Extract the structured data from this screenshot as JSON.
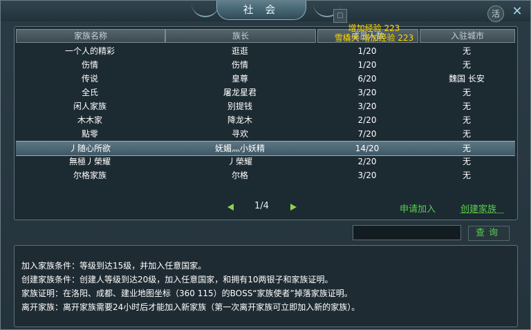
{
  "window": {
    "title": "社 会",
    "help_label": "活",
    "close_label": "✕",
    "square_btn_label": "□"
  },
  "table": {
    "columns": [
      "家族名称",
      "族长",
      "成员人数",
      "入驻城市"
    ],
    "rows": [
      [
        "一个人的精彩",
        "逛逛",
        "1/20",
        "无"
      ],
      [
        "伤情",
        "伤情",
        "1/20",
        "无"
      ],
      [
        "传说",
        "皇尊",
        "6/20",
        "魏国 长安"
      ],
      [
        "全氏",
        "屠龙星君",
        "3/20",
        "无"
      ],
      [
        "闲人家族",
        "别提钱",
        "3/20",
        "无"
      ],
      [
        "木木家",
        "降龙木",
        "2/20",
        "无"
      ],
      [
        "點零",
        "寻欢",
        "7/20",
        "无"
      ],
      [
        "丿随心所欲",
        "妩媚灬小妖精",
        "14/20",
        "无"
      ],
      [
        "無極丿榮耀",
        "丿榮耀",
        "2/20",
        "无"
      ],
      [
        "尔格家族",
        "尔格",
        "3/20",
        "无"
      ]
    ],
    "selected_index": 7
  },
  "xp_popup": {
    "line1": "增加经验 223",
    "line2": "雪橇犬 增加经验 223"
  },
  "pager": {
    "current": "1/4"
  },
  "actions": {
    "apply": "申请加入",
    "create": "创建家族",
    "search_placeholder": "",
    "query": "查询"
  },
  "info": {
    "join": "加入家族条件：等级到达15级，并加入任意国家。",
    "create": "创建家族条件：创建人等级到达20级，加入任意国家，和拥有10两银子和家族证明。",
    "proof": "家族证明：在洛阳、成都、建业地图坐标（360 115）的BOSS“家族使者”掉落家族证明。",
    "leave": "离开家族：离开家族需要24小时后才能加入新家族（第一次离开家族可立即加入新的家族）。"
  },
  "colors": {
    "link_green": "#58d04c",
    "popup_yellow": "#ffd900",
    "selected_row": "#4f6877"
  }
}
